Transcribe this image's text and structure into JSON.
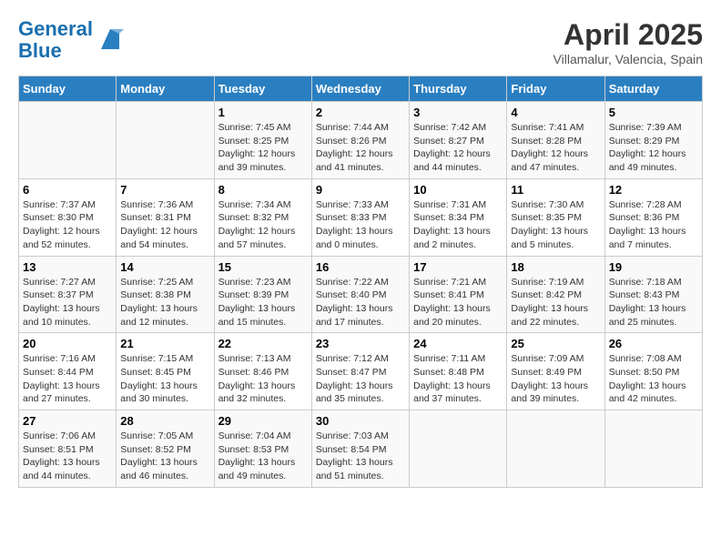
{
  "header": {
    "logo_line1": "General",
    "logo_line2": "Blue",
    "month_title": "April 2025",
    "location": "Villamalur, Valencia, Spain"
  },
  "days_of_week": [
    "Sunday",
    "Monday",
    "Tuesday",
    "Wednesday",
    "Thursday",
    "Friday",
    "Saturday"
  ],
  "weeks": [
    [
      {
        "date": "",
        "info": ""
      },
      {
        "date": "",
        "info": ""
      },
      {
        "date": "1",
        "info": "Sunrise: 7:45 AM\nSunset: 8:25 PM\nDaylight: 12 hours\nand 39 minutes."
      },
      {
        "date": "2",
        "info": "Sunrise: 7:44 AM\nSunset: 8:26 PM\nDaylight: 12 hours\nand 41 minutes."
      },
      {
        "date": "3",
        "info": "Sunrise: 7:42 AM\nSunset: 8:27 PM\nDaylight: 12 hours\nand 44 minutes."
      },
      {
        "date": "4",
        "info": "Sunrise: 7:41 AM\nSunset: 8:28 PM\nDaylight: 12 hours\nand 47 minutes."
      },
      {
        "date": "5",
        "info": "Sunrise: 7:39 AM\nSunset: 8:29 PM\nDaylight: 12 hours\nand 49 minutes."
      }
    ],
    [
      {
        "date": "6",
        "info": "Sunrise: 7:37 AM\nSunset: 8:30 PM\nDaylight: 12 hours\nand 52 minutes."
      },
      {
        "date": "7",
        "info": "Sunrise: 7:36 AM\nSunset: 8:31 PM\nDaylight: 12 hours\nand 54 minutes."
      },
      {
        "date": "8",
        "info": "Sunrise: 7:34 AM\nSunset: 8:32 PM\nDaylight: 12 hours\nand 57 minutes."
      },
      {
        "date": "9",
        "info": "Sunrise: 7:33 AM\nSunset: 8:33 PM\nDaylight: 13 hours\nand 0 minutes."
      },
      {
        "date": "10",
        "info": "Sunrise: 7:31 AM\nSunset: 8:34 PM\nDaylight: 13 hours\nand 2 minutes."
      },
      {
        "date": "11",
        "info": "Sunrise: 7:30 AM\nSunset: 8:35 PM\nDaylight: 13 hours\nand 5 minutes."
      },
      {
        "date": "12",
        "info": "Sunrise: 7:28 AM\nSunset: 8:36 PM\nDaylight: 13 hours\nand 7 minutes."
      }
    ],
    [
      {
        "date": "13",
        "info": "Sunrise: 7:27 AM\nSunset: 8:37 PM\nDaylight: 13 hours\nand 10 minutes."
      },
      {
        "date": "14",
        "info": "Sunrise: 7:25 AM\nSunset: 8:38 PM\nDaylight: 13 hours\nand 12 minutes."
      },
      {
        "date": "15",
        "info": "Sunrise: 7:23 AM\nSunset: 8:39 PM\nDaylight: 13 hours\nand 15 minutes."
      },
      {
        "date": "16",
        "info": "Sunrise: 7:22 AM\nSunset: 8:40 PM\nDaylight: 13 hours\nand 17 minutes."
      },
      {
        "date": "17",
        "info": "Sunrise: 7:21 AM\nSunset: 8:41 PM\nDaylight: 13 hours\nand 20 minutes."
      },
      {
        "date": "18",
        "info": "Sunrise: 7:19 AM\nSunset: 8:42 PM\nDaylight: 13 hours\nand 22 minutes."
      },
      {
        "date": "19",
        "info": "Sunrise: 7:18 AM\nSunset: 8:43 PM\nDaylight: 13 hours\nand 25 minutes."
      }
    ],
    [
      {
        "date": "20",
        "info": "Sunrise: 7:16 AM\nSunset: 8:44 PM\nDaylight: 13 hours\nand 27 minutes."
      },
      {
        "date": "21",
        "info": "Sunrise: 7:15 AM\nSunset: 8:45 PM\nDaylight: 13 hours\nand 30 minutes."
      },
      {
        "date": "22",
        "info": "Sunrise: 7:13 AM\nSunset: 8:46 PM\nDaylight: 13 hours\nand 32 minutes."
      },
      {
        "date": "23",
        "info": "Sunrise: 7:12 AM\nSunset: 8:47 PM\nDaylight: 13 hours\nand 35 minutes."
      },
      {
        "date": "24",
        "info": "Sunrise: 7:11 AM\nSunset: 8:48 PM\nDaylight: 13 hours\nand 37 minutes."
      },
      {
        "date": "25",
        "info": "Sunrise: 7:09 AM\nSunset: 8:49 PM\nDaylight: 13 hours\nand 39 minutes."
      },
      {
        "date": "26",
        "info": "Sunrise: 7:08 AM\nSunset: 8:50 PM\nDaylight: 13 hours\nand 42 minutes."
      }
    ],
    [
      {
        "date": "27",
        "info": "Sunrise: 7:06 AM\nSunset: 8:51 PM\nDaylight: 13 hours\nand 44 minutes."
      },
      {
        "date": "28",
        "info": "Sunrise: 7:05 AM\nSunset: 8:52 PM\nDaylight: 13 hours\nand 46 minutes."
      },
      {
        "date": "29",
        "info": "Sunrise: 7:04 AM\nSunset: 8:53 PM\nDaylight: 13 hours\nand 49 minutes."
      },
      {
        "date": "30",
        "info": "Sunrise: 7:03 AM\nSunset: 8:54 PM\nDaylight: 13 hours\nand 51 minutes."
      },
      {
        "date": "",
        "info": ""
      },
      {
        "date": "",
        "info": ""
      },
      {
        "date": "",
        "info": ""
      }
    ]
  ]
}
